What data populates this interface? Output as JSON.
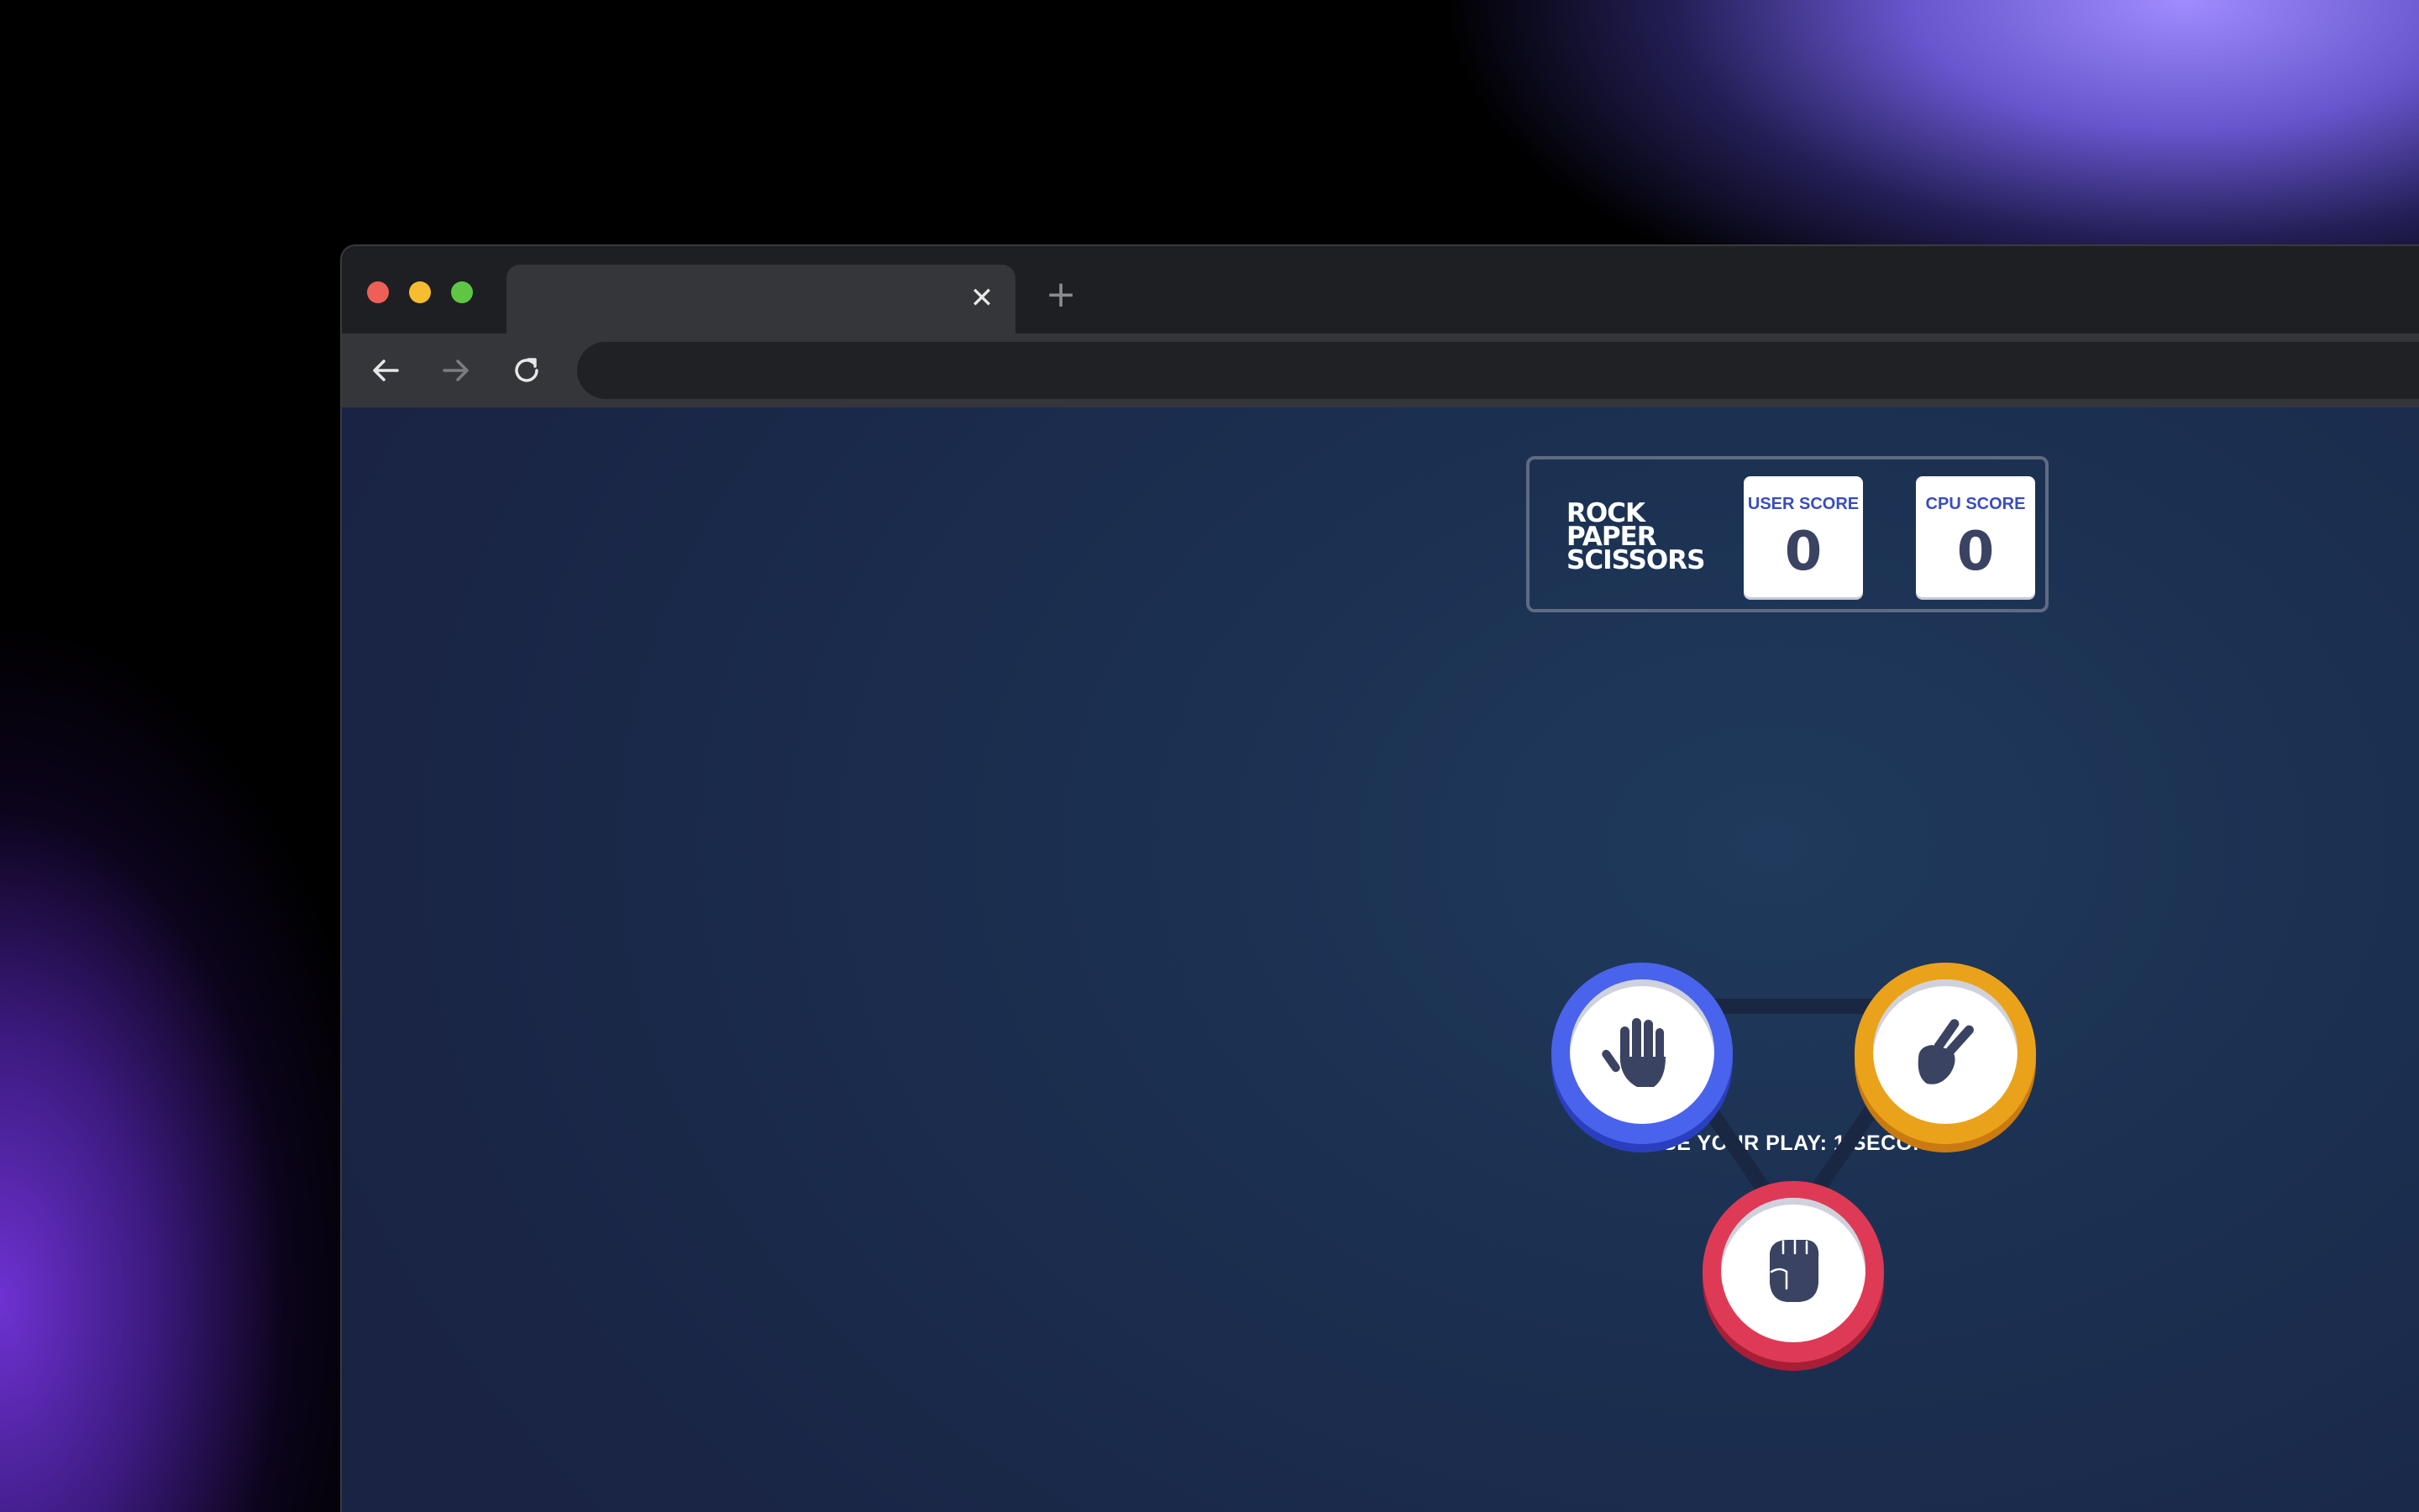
{
  "browser": {
    "tab": {
      "title": "",
      "close_glyph": "✕"
    },
    "new_tab_glyph": "+",
    "address": "",
    "buttons": [
      "back",
      "forward",
      "reload"
    ]
  },
  "game": {
    "title_lines": [
      "ROCK",
      "PAPER",
      "SCISSORS"
    ],
    "scores": {
      "user": {
        "label": "USER SCORE",
        "value": "0"
      },
      "cpu": {
        "label": "CPU SCORE",
        "value": "0"
      }
    },
    "prompt": "CHOSE YOUR PLAY: 1 SECONDS",
    "choices": [
      {
        "id": "paper",
        "icon": "paper-hand-icon",
        "color": "#4a63ec"
      },
      {
        "id": "scissors",
        "icon": "scissors-hand-icon",
        "color": "#eba21b"
      },
      {
        "id": "rock",
        "icon": "rock-fist-icon",
        "color": "#de3a56"
      }
    ]
  },
  "colors": {
    "page_bg": "#1b2f50",
    "score_label": "#3a4dbd",
    "score_value": "#3b4363",
    "icon": "#3b4363"
  }
}
